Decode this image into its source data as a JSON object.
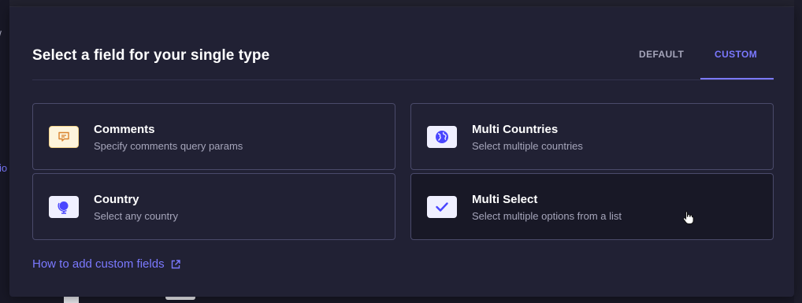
{
  "modal": {
    "title": "Select a field for your single type",
    "tabs": [
      {
        "label": "DEFAULT",
        "active": false
      },
      {
        "label": "CUSTOM",
        "active": true
      }
    ],
    "fields": [
      {
        "title": "Comments",
        "description": "Specify comments query params",
        "icon": "comment-icon"
      },
      {
        "title": "Multi Countries",
        "description": "Select multiple countries",
        "icon": "globe-icon"
      },
      {
        "title": "Country",
        "description": "Select any country",
        "icon": "globe-stand-icon"
      },
      {
        "title": "Multi Select",
        "description": "Select multiple options from a list",
        "icon": "check-icon"
      }
    ],
    "help_link": "How to add custom fields"
  },
  "background": {
    "left_text": "/",
    "left_link": "io"
  },
  "colors": {
    "accent": "#7b79ff",
    "modal_bg": "#212134",
    "border": "#4a4a6a",
    "comment_icon_bg": "#fdf4dc",
    "comment_icon_fg": "#d9822f",
    "icon_bg": "#f0f0ff"
  }
}
